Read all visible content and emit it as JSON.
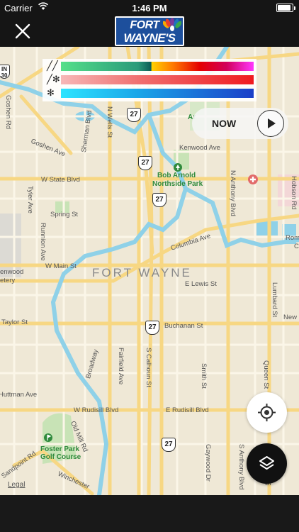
{
  "status": {
    "carrier": "Carrier",
    "time": "1:46 PM",
    "battery_level": 0.9
  },
  "header": {
    "logo_line1": "FORT",
    "logo_line2": "WAYNE'S"
  },
  "legend": [
    {
      "icon": "rain-icon",
      "glyph": "╱╱"
    },
    {
      "icon": "mix-icon",
      "glyph": "╱✻"
    },
    {
      "icon": "snow-icon",
      "glyph": "✻"
    }
  ],
  "controls": {
    "now_label": "NOW",
    "legal_label": "Legal"
  },
  "map": {
    "city_label": "FORT WAYNE",
    "routes": [
      "27",
      "27",
      "27",
      "27",
      "27",
      "27"
    ],
    "edge_shield": "IN\n30",
    "streets": {
      "goshen_rd": "Goshen Rd",
      "goshen_ave": "Goshen Ave",
      "n_wells_st": "N Wells St",
      "sherman_blvd": "Sherman Blvd",
      "kenwood_ave": "Kenwood Ave",
      "w_state_blvd": "W State Blvd",
      "tyler_ave": "Tyler Ave",
      "spring_st": "Spring St",
      "runnion_ave": "Runnion Ave",
      "n_anthony_blvd": "N Anthony Blvd",
      "hobson_rd": "Hobson Rd",
      "columbia_ave": "Columbia Ave",
      "w_main_st": "W Main St",
      "e_lewis_st": "E Lewis St",
      "lumbard_st": "Lumbard St",
      "taylor_st": "Taylor St",
      "buchanan_st": "Buchanan St",
      "new_haven": "New H",
      "broadway": "Broadway",
      "fairfield_ave": "Fairfield Ave",
      "s_calhoun_st": "S Calhoun St",
      "smith_st": "Smith St",
      "queen_st": "Queen St",
      "huffman": "Huttman Ave",
      "w_rudisill": "W Rudisill Blvd",
      "e_rudisill": "E Rudisill Blvd",
      "old_mill_rd": "Old Mill Rd",
      "sandpoint_rd": "Sandpoint Rd",
      "winchester": "Winchester",
      "gaywood_dr": "Gaywood Dr",
      "s_anthony_blvd": "S Anthony Blvd",
      "lindenwood": "enwood",
      "cemetery": "etery",
      "ar": "Ar",
      "rom": "Rom",
      "c": "C",
      "bl": "Bl"
    },
    "parks": {
      "bob_arnold_line1": "Bob Arnold",
      "bob_arnold_line2": "Northside Park",
      "foster_line1": "Foster Park",
      "foster_line2": "Golf Course"
    }
  },
  "colors": {
    "header_bg": "#151515",
    "map_bg": "#efe8d6",
    "road": "#f7d783",
    "river": "#8fd1e8",
    "park": "#c8e3b6",
    "logo_blue": "#1d4f9c"
  }
}
